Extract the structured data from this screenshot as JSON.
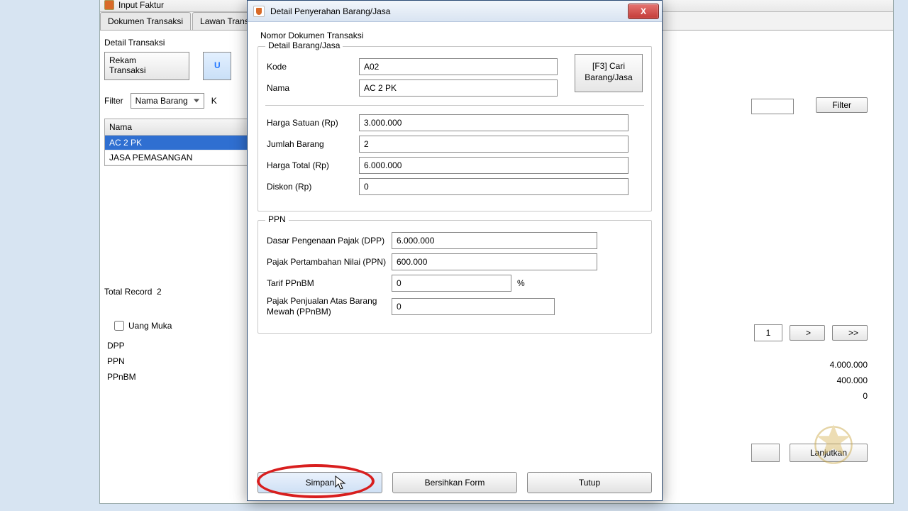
{
  "parent": {
    "title": "Input Faktur",
    "tabs": [
      "Dokumen Transaksi",
      "Lawan Transaksi"
    ],
    "detail_heading": "Detail Transaksi",
    "rekam_btn": "Rekam\nTransaksi",
    "other_btn_l": "U",
    "filter_label": "Filter",
    "filter_select": "Nama Barang",
    "filter_k": "K",
    "nama_header": "Nama",
    "nama_rows": [
      "AC 2 PK",
      "JASA PEMASANGAN"
    ],
    "total_record_label": "Total Record",
    "total_record_value": "2",
    "uang_muka": "Uang Muka",
    "summary_labels": [
      "DPP",
      "PPN",
      "PPnBM"
    ],
    "filter_btn": "Filter",
    "page_value": "1",
    "nav_next": ">",
    "nav_last": ">>",
    "summary_vals": [
      "4.000.000",
      "400.000",
      "0"
    ],
    "lanjutkan": "Lanjutkan"
  },
  "dialog": {
    "title": "Detail Penyerahan Barang/Jasa",
    "close_x": "X",
    "doknum": "Nomor Dokumen Transaksi",
    "group1_title": "Detail Barang/Jasa",
    "kode_label": "Kode",
    "kode_value": "A02",
    "nama_label": "Nama",
    "nama_value": "AC 2 PK",
    "cari_btn_line1": "[F3] Cari",
    "cari_btn_line2": "Barang/Jasa",
    "harga_satuan_label": "Harga Satuan (Rp)",
    "harga_satuan_value": "3.000.000",
    "jumlah_label": "Jumlah Barang",
    "jumlah_value": "2",
    "harga_total_label": "Harga Total (Rp)",
    "harga_total_value": "6.000.000",
    "diskon_label": "Diskon (Rp)",
    "diskon_value": "0",
    "ppn_title": "PPN",
    "dpp_label": "Dasar Pengenaan Pajak (DPP)",
    "dpp_value": "6.000.000",
    "ppn_label": "Pajak Pertambahan Nilai (PPN)",
    "ppn_value": "600.000",
    "tarif_label": "Tarif PPnBM",
    "tarif_value": "0",
    "pct": "%",
    "ppnbm_full_label": "Pajak Penjualan Atas Barang Mewah (PPnBM)",
    "ppnbm_value": "0",
    "btn_simpan": "Simpan",
    "btn_bersihkan": "Bersihkan Form",
    "btn_tutup": "Tutup"
  }
}
